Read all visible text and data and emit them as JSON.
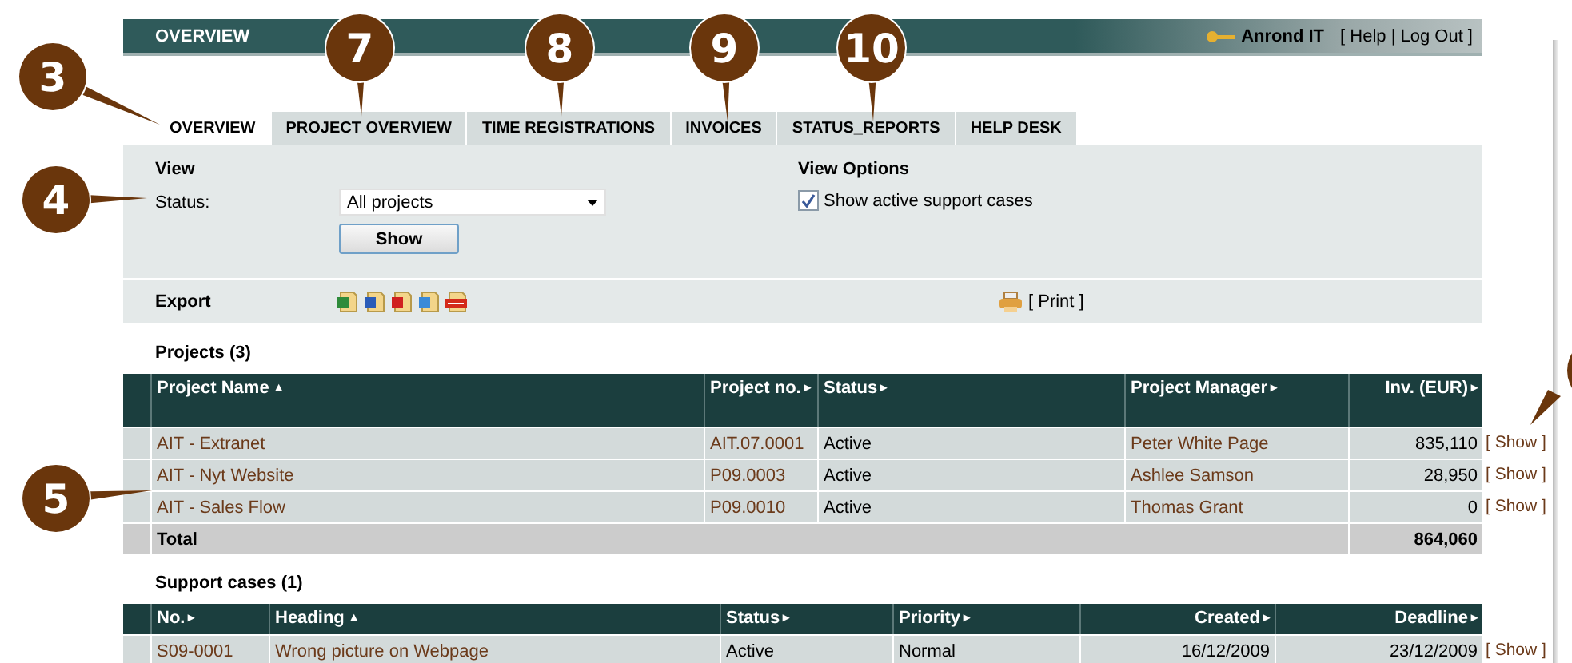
{
  "header": {
    "title": "OVERVIEW",
    "company": "Anrond IT",
    "user_links": "[ Help | Log Out ]"
  },
  "tabs": [
    {
      "label": "OVERVIEW",
      "selected": true
    },
    {
      "label": "PROJECT OVERVIEW",
      "selected": false
    },
    {
      "label": "TIME REGISTRATIONS",
      "selected": false
    },
    {
      "label": "INVOICES",
      "selected": false
    },
    {
      "label": "STATUS_REPORTS",
      "selected": false
    },
    {
      "label": "HELP DESK",
      "selected": false
    }
  ],
  "view": {
    "heading": "View",
    "status_label": "Status:",
    "status_value": "All projects",
    "button": "Show"
  },
  "view_options": {
    "heading": "View Options",
    "checkbox": {
      "label": "Show active support cases",
      "checked": true
    }
  },
  "export": {
    "label": "Export",
    "formats": [
      {
        "kind": "excel"
      },
      {
        "kind": "word"
      },
      {
        "kind": "pdf"
      },
      {
        "kind": "document"
      },
      {
        "kind": "xml"
      }
    ],
    "print": "[ Print ]"
  },
  "projects": {
    "title": "Projects (3)",
    "columns": [
      {
        "label": "Project Name",
        "sort_mark": "▲"
      },
      {
        "label": "Project no.",
        "sort_mark": "▸"
      },
      {
        "label": "Status",
        "sort_mark": "▸"
      },
      {
        "label": "Project Manager",
        "sort_mark": "▸"
      },
      {
        "label": "Inv. (EUR)",
        "sort_mark": "▸"
      }
    ],
    "rows": [
      {
        "cells": [
          "AIT - Extranet",
          "AIT.07.0001",
          "Active",
          "Peter White Page",
          "835,110"
        ],
        "action": "[ Show ]"
      },
      {
        "cells": [
          "AIT - Nyt Website",
          "P09.0003",
          "Active",
          "Ashlee Samson",
          "28,950"
        ],
        "action": "[ Show ]"
      },
      {
        "cells": [
          "AIT - Sales Flow",
          "P09.0010",
          "Active",
          "Thomas Grant",
          "0"
        ],
        "action": "[ Show ]"
      }
    ],
    "total": {
      "label": "Total",
      "value": "864,060"
    }
  },
  "support_cases": {
    "title": "Support cases (1)",
    "columns": [
      {
        "label": "No.",
        "sort_mark": "▸"
      },
      {
        "label": "Heading",
        "sort_mark": "▲"
      },
      {
        "label": "Status",
        "sort_mark": "▸"
      },
      {
        "label": "Priority",
        "sort_mark": "▸"
      },
      {
        "label": "Created",
        "sort_mark": "▸"
      },
      {
        "label": "Deadline",
        "sort_mark": "▸"
      }
    ],
    "rows": [
      {
        "cells": [
          "S09-0001",
          "Wrong picture on Webpage",
          "Active",
          "Normal",
          "16/12/2009",
          "23/12/2009"
        ],
        "action": "[ Show ]"
      }
    ]
  },
  "callouts": [
    {
      "number": "3"
    },
    {
      "number": "7"
    },
    {
      "number": "8"
    },
    {
      "number": "9"
    },
    {
      "number": "10"
    },
    {
      "number": "4"
    },
    {
      "number": "5"
    }
  ]
}
